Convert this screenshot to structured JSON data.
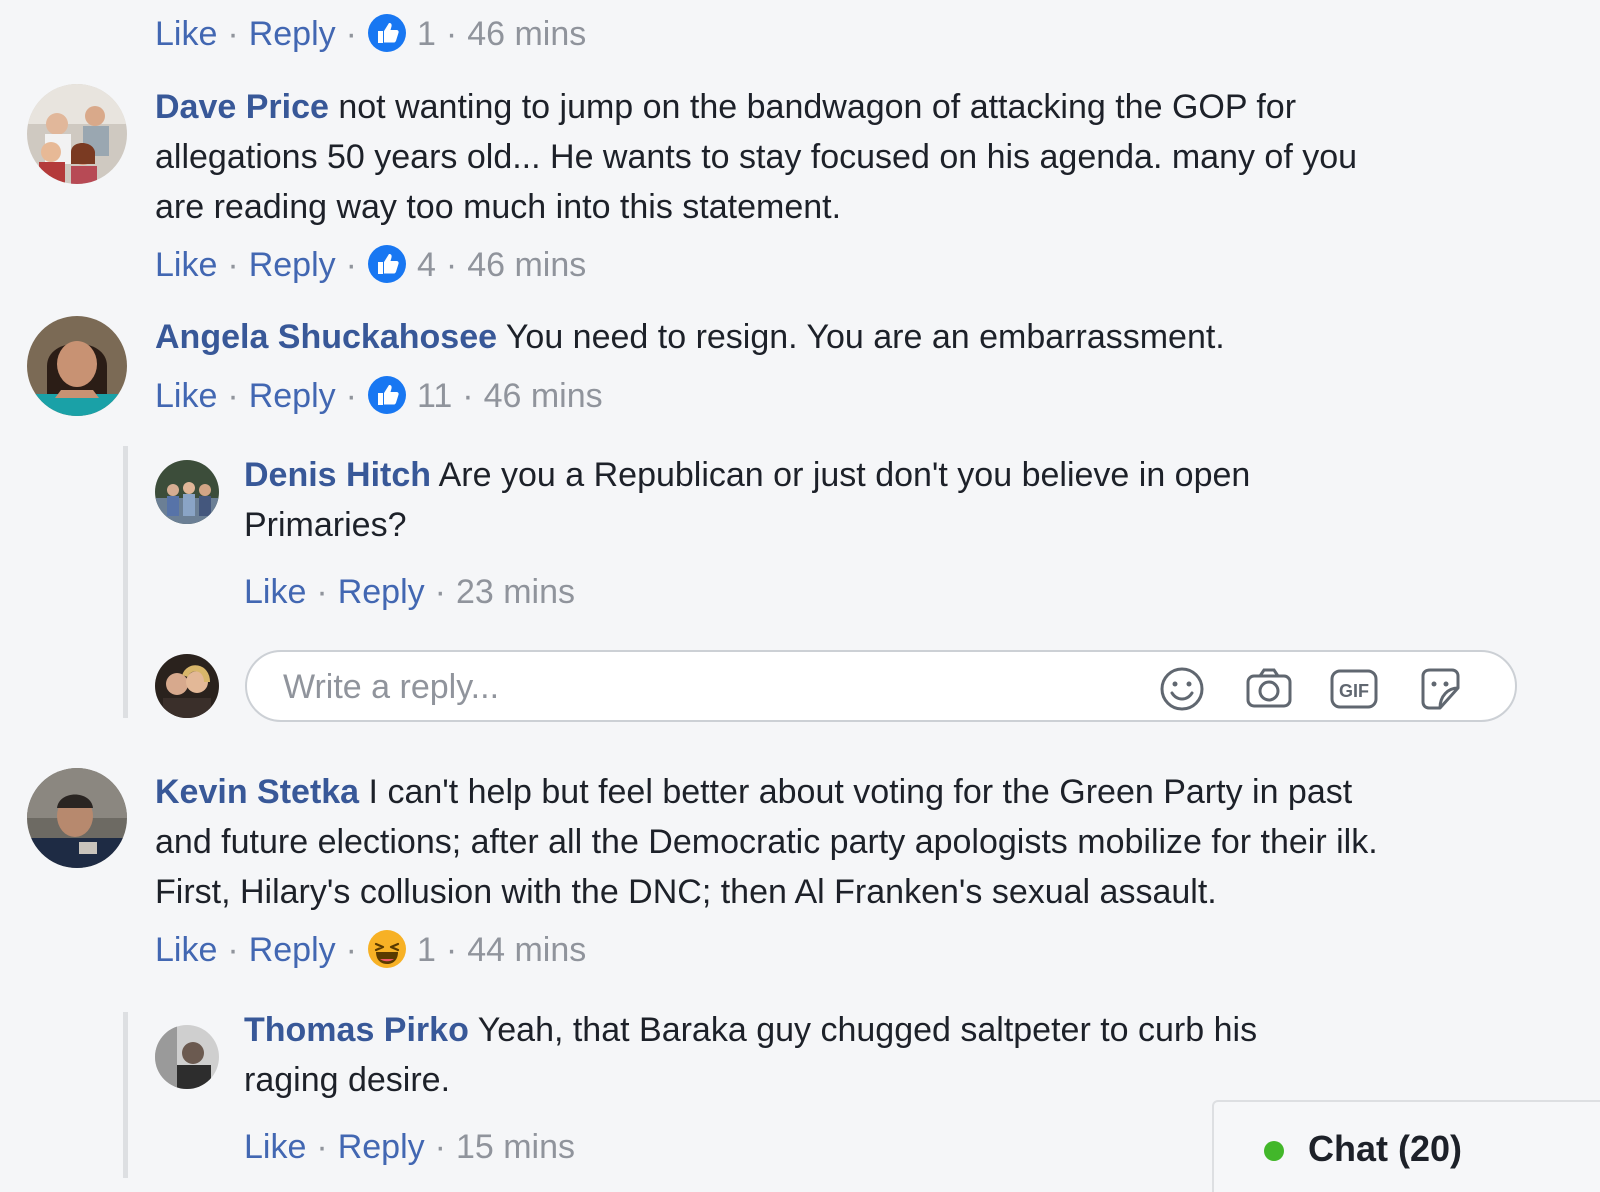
{
  "comments": [
    {
      "actions": {
        "like": "Like",
        "reply": "Reply",
        "reaction": "like",
        "count": "1",
        "time": "46 mins"
      }
    },
    {
      "author": "Dave Price",
      "lines": [
        "not wanting to jump on the bandwagon of attacking the GOP for",
        "allegations 50 years old... He wants to stay focused on his agenda. many of you",
        "are reading way too much into this statement."
      ],
      "actions": {
        "like": "Like",
        "reply": "Reply",
        "reaction": "like",
        "count": "4",
        "time": "46 mins"
      }
    },
    {
      "author": "Angela Shuckahosee",
      "lines": [
        "You need to resign. You are an embarrassment."
      ],
      "actions": {
        "like": "Like",
        "reply": "Reply",
        "reaction": "like",
        "count": "11",
        "time": "46 mins"
      },
      "replies": [
        {
          "author": "Denis Hitch",
          "lines": [
            "Are you a Republican or just don't you believe in open",
            "Primaries?"
          ],
          "actions": {
            "like": "Like",
            "reply": "Reply",
            "time": "23 mins"
          }
        }
      ],
      "reply_box": {
        "placeholder": "Write a reply...",
        "icons": [
          "emoji-icon",
          "camera-icon",
          "gif-icon",
          "sticker-icon"
        ],
        "gif_label": "GIF"
      }
    },
    {
      "author": "Kevin Stetka",
      "lines": [
        "I can't help but feel better about voting for the Green Party in past",
        "and future elections; after all the Democratic party apologists mobilize for their ilk.",
        "First, Hilary's collusion with the DNC; then Al Franken's sexual assault."
      ],
      "actions": {
        "like": "Like",
        "reply": "Reply",
        "reaction": "haha",
        "count": "1",
        "time": "44 mins"
      },
      "replies": [
        {
          "author": "Thomas Pirko",
          "lines": [
            "Yeah, that Baraka guy chugged saltpeter to curb his",
            "raging desire."
          ],
          "actions": {
            "like": "Like",
            "reply": "Reply",
            "time": "15 mins"
          }
        }
      ]
    }
  ],
  "chat": {
    "label": "Chat (20)",
    "status_color": "#42b72a"
  },
  "colors": {
    "link": "#4267b2",
    "name": "#385898",
    "meta": "#90949c",
    "like_reaction": "#1877f2",
    "haha_reaction": "#f7b125"
  }
}
